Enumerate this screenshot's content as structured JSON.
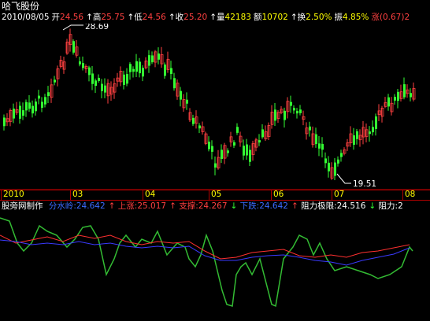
{
  "title": "哈飞股份",
  "info": {
    "date": "2010/08/05",
    "open_label": "开",
    "open": "24.56",
    "high_label": "高",
    "high": "25.75",
    "low_label": "低",
    "low": "24.56",
    "close_label": "收",
    "close": "25.20",
    "volume_label": "量",
    "volume": "42183",
    "amount_label": "额",
    "amount": "10702",
    "turnover_label": "换",
    "turnover": "2.50%",
    "amplitude_label": "振",
    "amplitude": "4.85%",
    "change_label": "涨",
    "change": "(0.67)2"
  },
  "price_high_marker": "28.69",
  "price_low_marker": "19.51",
  "x_axis_labels": [
    "2010",
    "03",
    "04",
    "05",
    "06",
    "07",
    "08"
  ],
  "indicator": {
    "name": "股旁网制作",
    "items": [
      {
        "text": "分水岭:24.642",
        "color": "#3a6bff"
      },
      {
        "text": "上涨:25.017",
        "color": "#ff4040"
      },
      {
        "text": "支撑:24.267",
        "color": "#ff4040"
      },
      {
        "text": "下跌:24.642",
        "color": "#3a6bff"
      },
      {
        "text": "阻力极限:24.516",
        "color": "#ffffff"
      },
      {
        "text": "阻力:2",
        "color": "#ffffff"
      }
    ]
  },
  "colors": {
    "up": "#ff4040",
    "down": "#33ff33",
    "grid": "#8b0000",
    "axis": "#b00000",
    "text_white": "#ffffff",
    "text_yellow": "#ffff00",
    "text_red": "#ff4040",
    "line_blue": "#3a3aff",
    "line_red": "#ff3030",
    "line_green": "#33bb33"
  }
}
